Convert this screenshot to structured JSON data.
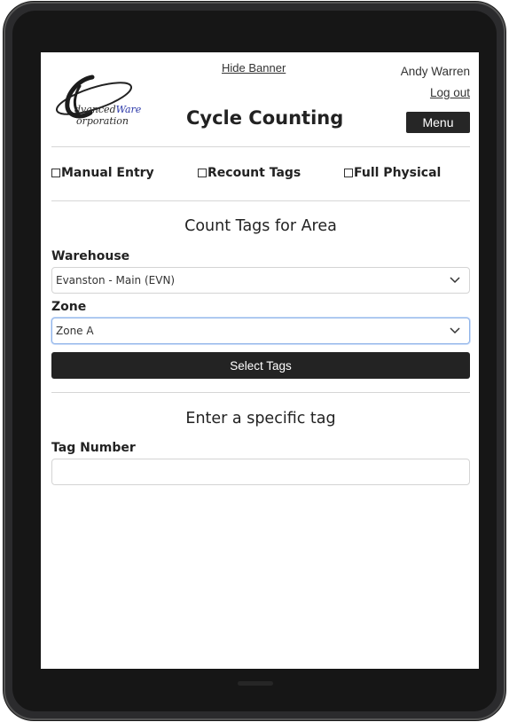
{
  "banner": {
    "logo_line1": "dvanced",
    "logo_line1_brand": "Ware",
    "logo_line2": "orporation",
    "hide_banner_label": "Hide Banner",
    "title": "Cycle Counting",
    "user_name": "Andy Warren",
    "logout_label": "Log out",
    "menu_label": "Menu"
  },
  "options": {
    "manual_entry": "Manual Entry",
    "recount_tags": "Recount Tags",
    "full_physical": "Full Physical"
  },
  "count_area": {
    "heading": "Count Tags for Area",
    "warehouse_label": "Warehouse",
    "warehouse_value": "Evanston - Main (EVN)",
    "zone_label": "Zone",
    "zone_value": "Zone A",
    "select_tags_label": "Select Tags"
  },
  "specific_tag": {
    "heading": "Enter a specific tag",
    "tag_number_label": "Tag Number",
    "tag_number_value": ""
  },
  "colors": {
    "button_dark": "#232323",
    "focus_border": "#8fb3e8",
    "logo_blue": "#2a37a8"
  }
}
